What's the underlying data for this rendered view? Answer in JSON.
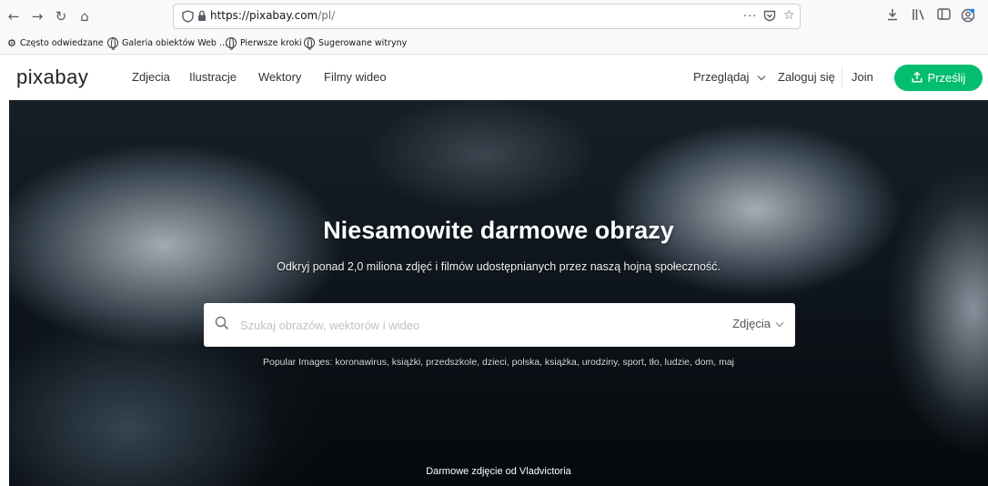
{
  "browser": {
    "url_host": "https://pixabay.com",
    "url_path": "/pl/",
    "overflow": "···"
  },
  "bookmarks": [
    {
      "label": "Często odwiedzane"
    },
    {
      "label": "Galeria obiektów Web ..."
    },
    {
      "label": "Pierwsze kroki"
    },
    {
      "label": "Sugerowane witryny"
    }
  ],
  "site": {
    "logo": "pixabay",
    "nav": [
      "Zdjecia",
      "Ilustracje",
      "Wektory",
      "Filmy wideo"
    ],
    "browse": "Przeglądaj",
    "login": "Zaloguj się",
    "join": "Join",
    "upload": "Prześlij"
  },
  "hero": {
    "title": "Niesamowite darmowe obrazy",
    "subtitle": "Odkryj ponad 2,0 miliona zdjęć i filmów udostępnianych przez naszą hojną społeczność.",
    "search_placeholder": "Szukaj obrazów, wektorów i wideo",
    "search_type": "Zdjęcia",
    "popular": "Popular Images: koronawirus, książki, przedszkole, dzieci, polska, książka, urodziny, sport, tło, ludzie, dom, maj",
    "credit": "Darmowe zdjęcie od Vladvictoria"
  },
  "colors": {
    "accent": "#02be6e"
  }
}
